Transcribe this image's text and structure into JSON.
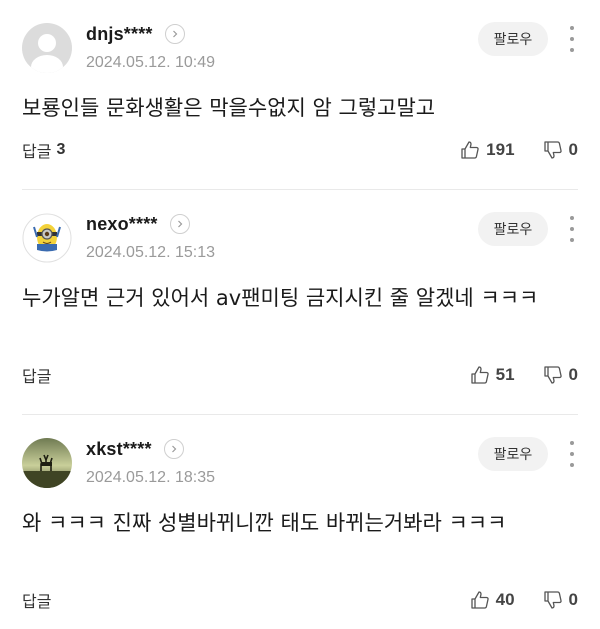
{
  "comments": [
    {
      "user": "dnjs****",
      "date": "2024.05.12. 10:49",
      "text": "보룡인들 문화생활은 막을수없지 암 그렇고말고",
      "reply_label": "답글",
      "reply_count": "3",
      "likes": "191",
      "dislikes": "0",
      "follow_label": "팔로우",
      "avatar": "default-user-icon"
    },
    {
      "user": "nexo****",
      "date": "2024.05.12. 15:13",
      "text": "누가알면 근거 있어서 av팬미팅 금지시킨 줄 알겠네 ㅋㅋㅋ",
      "reply_label": "답글",
      "reply_count": "",
      "likes": "51",
      "dislikes": "0",
      "follow_label": "팔로우",
      "avatar": "minion-icon"
    },
    {
      "user": "xkst****",
      "date": "2024.05.12. 18:35",
      "text": "와 ㅋㅋㅋ 진짜 성별바뀌니깐 태도 바뀌는거봐라 ㅋㅋㅋ",
      "reply_label": "답글",
      "reply_count": "",
      "likes": "40",
      "dislikes": "0",
      "follow_label": "팔로우",
      "avatar": "deer-landscape-icon"
    }
  ],
  "colors": {
    "text": "#1a1a1a",
    "muted": "#9a9a9a",
    "follow_bg": "#f2f2f2",
    "divider": "#e9e9e9"
  }
}
